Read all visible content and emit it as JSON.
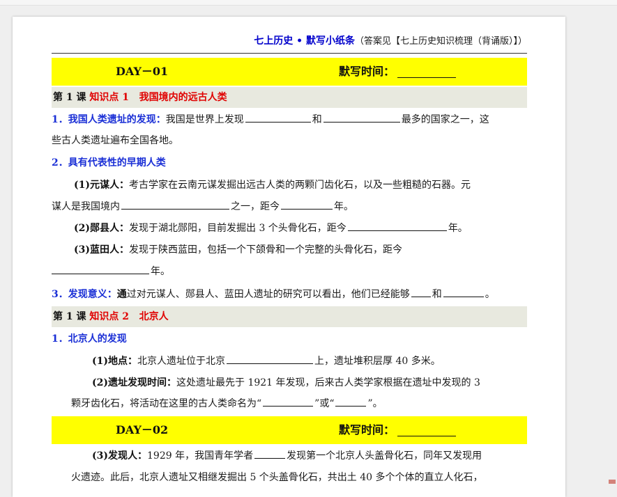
{
  "header": {
    "title": "七上历史 • 默写小纸条",
    "note": "（答案见【七上历史知识梳理（背诵版）】）"
  },
  "day1": {
    "label": "DAY－01",
    "time_label": "默写时间："
  },
  "day2": {
    "label": "DAY－02",
    "time_label": "默写时间："
  },
  "lesson1": {
    "prefix": "第 1 课",
    "kp": "知识点 1",
    "title": "我国境内的远古人类"
  },
  "lesson2": {
    "prefix": "第 1 课",
    "kp": "知识点 2",
    "title": "北京人"
  },
  "s1": {
    "heading": "1．我国人类遗址的发现：",
    "t1": "我国是世界上发现",
    "t2": "和",
    "t3": "最多的国家之一，这",
    "t4": "些古人类遗址遍布全国各地。"
  },
  "s2": {
    "heading": "2．具有代表性的早期人类"
  },
  "yuanmou": {
    "label": "(1)元谋人：",
    "t1": "考古学家在云南元谋发掘出远古人类的两颗门齿化石，以及一些粗糙的石器。元",
    "t2": "谋人是我国境内",
    "t3": "之一，距今",
    "t4": "年。"
  },
  "yunxian": {
    "label": "(2)郧县人：",
    "t1": "发现于湖北郧阳，目前发掘出 3 个头骨化石，距今",
    "t2": "年。"
  },
  "lantian": {
    "label": "(3)蓝田人：",
    "t1": "发现于陕西蓝田，包括一个下颌骨和一个完整的头骨化石，距今",
    "t2": "年。"
  },
  "s3": {
    "heading": "3．发现意义：",
    "lead": "通",
    "t1": "过对元谋人、郧县人、蓝田人遗址的研究可以看出，他们已经能够",
    "t2": "和",
    "t3": "。"
  },
  "bj": {
    "heading": "1．北京人的发现",
    "loc_label": "(1)地点：",
    "loc_t1": "北京人遗址位于北京",
    "loc_t2": "上，遗址堆积层厚 40 多米。",
    "time_label": "(2)遗址发现时间：",
    "time_t1": "这处遗址最先于 1921 年发现，后来古人类学家根据在遗址中发现的 3",
    "time_t2": "颗牙齿化石，将活动在这里的古人类命名为“",
    "time_t3": "”或“",
    "time_t4": "”。",
    "who_label": "(3)发现人：",
    "who_t1": "1929 年，我国青年学者",
    "who_t2": "发现第一个北京人头盖骨化石，同年又发现用",
    "who_t3": "火遗迹。此后，北京人遗址又相继发掘出 5 个头盖骨化石，共出土 40 多个个体的直立人化石，"
  }
}
